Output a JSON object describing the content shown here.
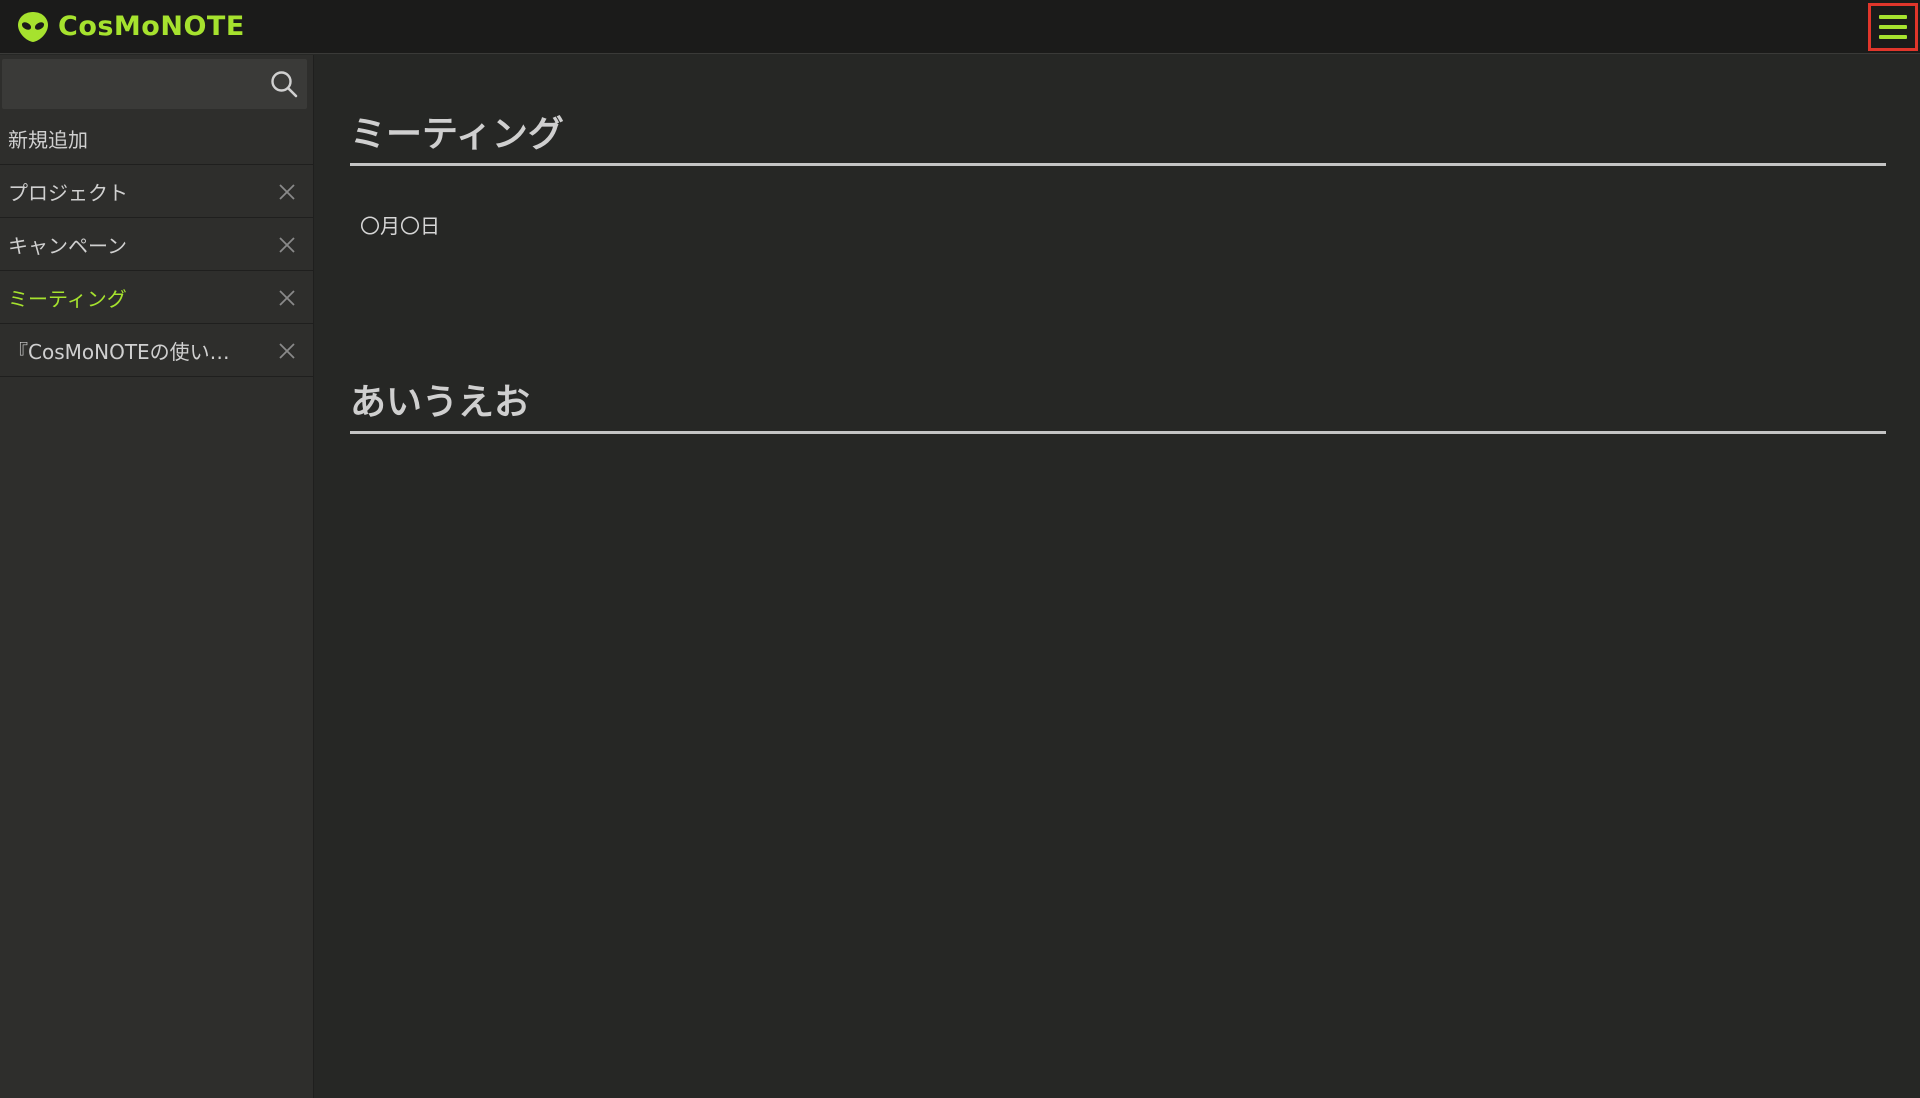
{
  "header": {
    "app_name": "CosMoNOTE",
    "logo_icon": "alien-head-icon",
    "menu_icon": "hamburger-menu-icon",
    "accent_color": "#a6e22e",
    "highlight_color": "#e0362b"
  },
  "sidebar": {
    "search": {
      "value": "",
      "placeholder": "",
      "icon": "search-icon"
    },
    "add_new_label": "新規追加",
    "items": [
      {
        "label": "プロジェクト",
        "active": false
      },
      {
        "label": "キャンペーン",
        "active": false
      },
      {
        "label": "ミーティング",
        "active": true
      },
      {
        "label": "『CosMoNOTEの使い…",
        "active": false
      }
    ]
  },
  "main": {
    "sections": [
      {
        "title": "ミーティング",
        "body": "〇月〇日"
      },
      {
        "title": "あいうえお",
        "body": ""
      }
    ]
  }
}
